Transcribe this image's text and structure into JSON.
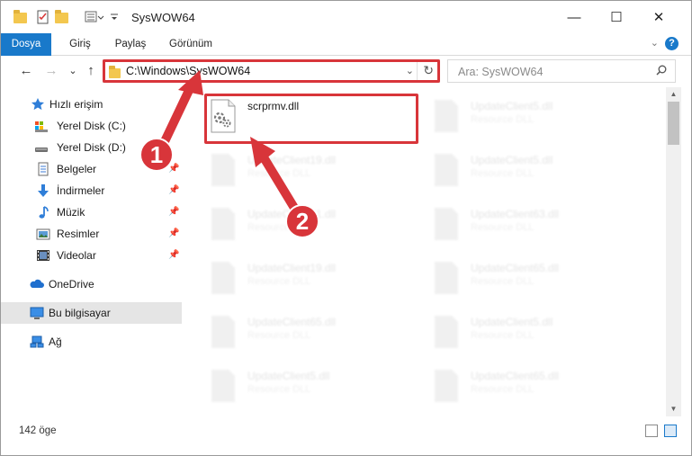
{
  "window": {
    "title": "SysWOW64",
    "controls": {
      "minimize": "—",
      "maximize": "☐",
      "close": "✕"
    }
  },
  "ribbon": {
    "tabs": [
      {
        "label": "Dosya",
        "active": true
      },
      {
        "label": "Giriş",
        "active": false
      },
      {
        "label": "Paylaş",
        "active": false
      },
      {
        "label": "Görünüm",
        "active": false
      }
    ],
    "help": "?"
  },
  "nav": {
    "back": "←",
    "forward": "→",
    "recent": "⌄",
    "up": "↑",
    "address": "C:\\Windows\\SysWOW64",
    "search_placeholder": "Ara: SysWOW64"
  },
  "sidebar": {
    "items": [
      {
        "label": "Hızlı erişim",
        "icon": "star-icon",
        "pinned": false,
        "selected": false
      },
      {
        "label": "Yerel Disk (C:)",
        "icon": "drive-icon",
        "pinned": false,
        "selected": false
      },
      {
        "label": "Yerel Disk (D:)",
        "icon": "drive-icon",
        "pinned": false,
        "selected": false
      },
      {
        "label": "Belgeler",
        "icon": "documents-icon",
        "pinned": true,
        "selected": false
      },
      {
        "label": "İndirmeler",
        "icon": "download-icon",
        "pinned": true,
        "selected": false
      },
      {
        "label": "Müzik",
        "icon": "music-icon",
        "pinned": true,
        "selected": false
      },
      {
        "label": "Resimler",
        "icon": "pictures-icon",
        "pinned": true,
        "selected": false
      },
      {
        "label": "Videolar",
        "icon": "videos-icon",
        "pinned": true,
        "selected": false
      },
      {
        "label": "OneDrive",
        "icon": "cloud-icon",
        "pinned": false,
        "selected": false
      },
      {
        "label": "Bu bilgisayar",
        "icon": "computer-icon",
        "pinned": false,
        "selected": true
      },
      {
        "label": "Ağ",
        "icon": "network-icon",
        "pinned": false,
        "selected": false
      }
    ]
  },
  "files": {
    "highlighted": {
      "name": "scrprmv.dll"
    },
    "ghost": [
      {
        "name": "UpdateClient5.dll",
        "type": "Resource DLL"
      },
      {
        "name": "UpdateClient19.dll",
        "type": "Resource DLL"
      },
      {
        "name": "UpdateClient5.dll",
        "type": "Resource DLL"
      },
      {
        "name": "UpdateClient21.dll",
        "type": "Resource DLL"
      },
      {
        "name": "UpdateClient63.dll",
        "type": "Resource DLL"
      },
      {
        "name": "UpdateClient19.dll",
        "type": "Resource DLL"
      },
      {
        "name": "UpdateClient65.dll",
        "type": "Resource DLL"
      },
      {
        "name": "UpdateClient65.dll",
        "type": "Resource DLL"
      },
      {
        "name": "UpdateClient5.dll",
        "type": "Resource DLL"
      },
      {
        "name": "UpdateClient5.dll",
        "type": "Resource DLL"
      },
      {
        "name": "UpdateClient65.dll",
        "type": "Resource DLL"
      }
    ]
  },
  "annotations": {
    "arrow1_label": "1",
    "arrow2_label": "2",
    "color": "#d8353a"
  },
  "status": {
    "count": "142 öge"
  }
}
